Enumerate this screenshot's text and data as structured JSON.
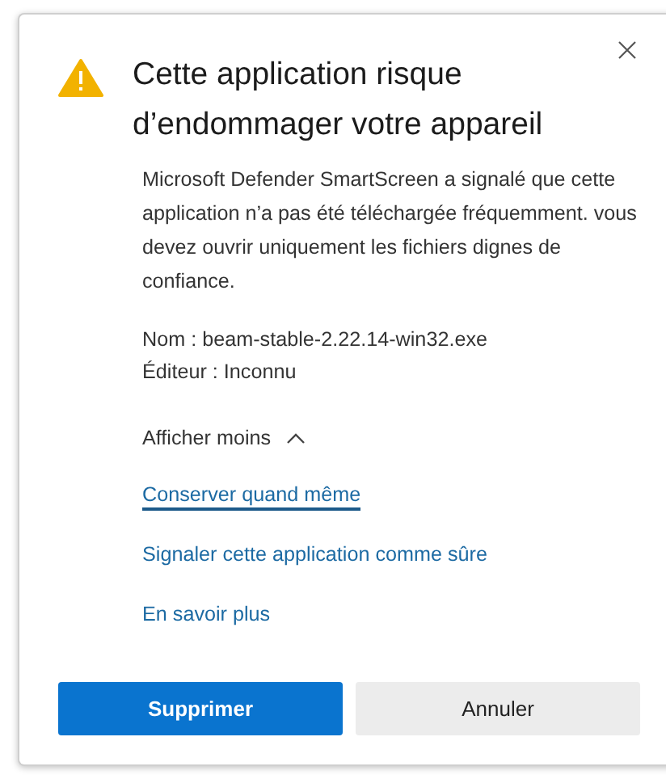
{
  "dialog": {
    "title": "Cette application risque d’endommager votre appareil",
    "message": "Microsoft Defender SmartScreen a signalé que cette application n’a pas été téléchargée fréquemment. vous devez ouvrir uniquement les fichiers dignes de confiance.",
    "details": [
      "Nom : beam-stable-2.22.14-win32.exe",
      "Éditeur : Inconnu"
    ],
    "toggle": {
      "label": "Afficher moins",
      "expanded": true
    },
    "links": [
      {
        "label": "Conserver quand même",
        "focused": true
      },
      {
        "label": "Signaler cette application comme sûre",
        "focused": false
      },
      {
        "label": "En savoir plus",
        "focused": false
      }
    ],
    "buttons": [
      {
        "label": "Supprimer",
        "kind": "primary"
      },
      {
        "label": "Annuler",
        "kind": "secondary"
      }
    ]
  }
}
